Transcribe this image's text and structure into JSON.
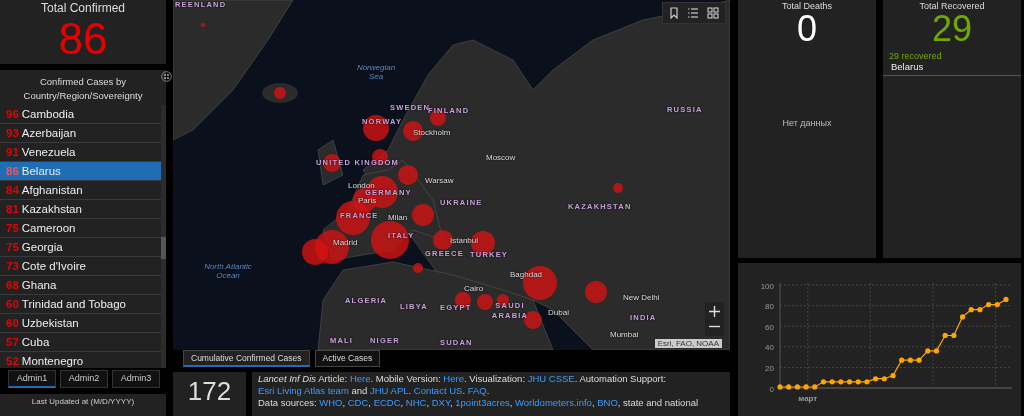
{
  "total_confirmed": {
    "title": "Total Confirmed",
    "value": "86"
  },
  "cases_list": {
    "title": "Confirmed Cases by Country/Region/Sovereignty",
    "rows": [
      {
        "count": "96",
        "name": "Cambodia",
        "selected": false
      },
      {
        "count": "93",
        "name": "Azerbaijan",
        "selected": false
      },
      {
        "count": "91",
        "name": "Venezuela",
        "selected": false
      },
      {
        "count": "86",
        "name": "Belarus",
        "selected": true
      },
      {
        "count": "84",
        "name": "Afghanistan",
        "selected": false
      },
      {
        "count": "81",
        "name": "Kazakhstan",
        "selected": false
      },
      {
        "count": "75",
        "name": "Cameroon",
        "selected": false
      },
      {
        "count": "75",
        "name": "Georgia",
        "selected": false
      },
      {
        "count": "73",
        "name": "Cote d'Ivoire",
        "selected": false
      },
      {
        "count": "68",
        "name": "Ghana",
        "selected": false
      },
      {
        "count": "60",
        "name": "Trinidad and Tobago",
        "selected": false
      },
      {
        "count": "60",
        "name": "Uzbekistan",
        "selected": false
      },
      {
        "count": "57",
        "name": "Cuba",
        "selected": false
      },
      {
        "count": "52",
        "name": "Montenegro",
        "selected": false
      }
    ]
  },
  "admin_tabs": [
    {
      "label": "Admin1",
      "selected": true
    },
    {
      "label": "Admin2",
      "selected": false
    },
    {
      "label": "Admin3",
      "selected": false
    }
  ],
  "last_updated": {
    "label": "Last Updated at (M/D/YYYY)"
  },
  "map": {
    "labels": [
      {
        "text": "REENLAND",
        "kind": "country"
      },
      {
        "text": "Norwegian Sea",
        "kind": "water"
      },
      {
        "text": "SWEDEN",
        "kind": "country"
      },
      {
        "text": "FINLAND",
        "kind": "country"
      },
      {
        "text": "NORWAY",
        "kind": "country"
      },
      {
        "text": "RUSSIA",
        "kind": "country"
      },
      {
        "text": "Stockholm",
        "kind": "city"
      },
      {
        "text": "Moscow",
        "kind": "city"
      },
      {
        "text": "UNITED KINGDOM",
        "kind": "country"
      },
      {
        "text": "London",
        "kind": "city"
      },
      {
        "text": "Warsaw",
        "kind": "city"
      },
      {
        "text": "GERMANY",
        "kind": "country"
      },
      {
        "text": "Paris",
        "kind": "city"
      },
      {
        "text": "UKRAINE",
        "kind": "country"
      },
      {
        "text": "KAZAKHSTAN",
        "kind": "country"
      },
      {
        "text": "FRANCE",
        "kind": "country"
      },
      {
        "text": "Milan",
        "kind": "city"
      },
      {
        "text": "ITALY",
        "kind": "country"
      },
      {
        "text": "Madrid",
        "kind": "city"
      },
      {
        "text": "Istanbul",
        "kind": "city"
      },
      {
        "text": "North Atlantic Ocean",
        "kind": "water"
      },
      {
        "text": "GREECE",
        "kind": "country"
      },
      {
        "text": "TURKEY",
        "kind": "country"
      },
      {
        "text": "Baghdad",
        "kind": "city"
      },
      {
        "text": "Cairo",
        "kind": "city"
      },
      {
        "text": "ALGERIA",
        "kind": "country"
      },
      {
        "text": "LIBYA",
        "kind": "country"
      },
      {
        "text": "EGYPT",
        "kind": "country"
      },
      {
        "text": "SAUDI ARABIA",
        "kind": "country"
      },
      {
        "text": "New Delhi",
        "kind": "city"
      },
      {
        "text": "Dubai",
        "kind": "city"
      },
      {
        "text": "INDIA",
        "kind": "country"
      },
      {
        "text": "Mumbai",
        "kind": "city"
      },
      {
        "text": "MALI",
        "kind": "country"
      },
      {
        "text": "NIGER",
        "kind": "country"
      },
      {
        "text": "SUDAN",
        "kind": "country"
      }
    ],
    "attribution": "Esri, FAO, NOAA"
  },
  "map_tabs": [
    {
      "label": "Cumulative Confirmed Cases",
      "selected": true
    },
    {
      "label": "Active Cases",
      "selected": false
    }
  ],
  "country_count": "172",
  "info": {
    "segments": [
      {
        "kind": "italic",
        "text": "Lancet Inf Dis"
      },
      {
        "kind": "text",
        "text": " Article: "
      },
      {
        "kind": "link",
        "text": "Here"
      },
      {
        "kind": "text",
        "text": ". Mobile Version: "
      },
      {
        "kind": "link",
        "text": "Here"
      },
      {
        "kind": "text",
        "text": ". Visualization: "
      },
      {
        "kind": "link",
        "text": "JHU CSSE"
      },
      {
        "kind": "text",
        "text": ". Automation Support: "
      },
      {
        "kind": "link",
        "text": "Esri Living Atlas team"
      },
      {
        "kind": "text",
        "text": " and "
      },
      {
        "kind": "link",
        "text": "JHU APL"
      },
      {
        "kind": "text",
        "text": ". "
      },
      {
        "kind": "link",
        "text": "Contact US"
      },
      {
        "kind": "text",
        "text": ". "
      },
      {
        "kind": "link",
        "text": "FAQ"
      },
      {
        "kind": "text",
        "text": "."
      },
      {
        "kind": "break"
      },
      {
        "kind": "text",
        "text": "Data sources: "
      },
      {
        "kind": "link",
        "text": "WHO"
      },
      {
        "kind": "text",
        "text": ", "
      },
      {
        "kind": "link",
        "text": "CDC"
      },
      {
        "kind": "text",
        "text": ", "
      },
      {
        "kind": "link",
        "text": "ECDC"
      },
      {
        "kind": "text",
        "text": ", "
      },
      {
        "kind": "link",
        "text": "NHC"
      },
      {
        "kind": "text",
        "text": ", "
      },
      {
        "kind": "link",
        "text": "DXY"
      },
      {
        "kind": "text",
        "text": ", "
      },
      {
        "kind": "link",
        "text": "1point3acres"
      },
      {
        "kind": "text",
        "text": ", "
      },
      {
        "kind": "link",
        "text": "Worldometers.info"
      },
      {
        "kind": "text",
        "text": ", "
      },
      {
        "kind": "link",
        "text": "BNO"
      },
      {
        "kind": "text",
        "text": ", state and national"
      }
    ]
  },
  "total_deaths": {
    "title": "Total Deaths",
    "value": "0",
    "empty_message": "Нет данных"
  },
  "total_recovered": {
    "title": "Total Recovered",
    "value": "29",
    "items": [
      {
        "count": "29",
        "label": "recovered",
        "place": "Belarus"
      }
    ]
  },
  "trend": {
    "chart_data": {
      "type": "line",
      "grid": true,
      "series": [
        {
          "color": "#ffa500",
          "values": [
            1,
            1,
            1,
            1,
            1,
            6,
            6,
            6,
            6,
            6,
            6,
            9,
            9,
            12,
            27,
            27,
            27,
            36,
            36,
            51,
            51,
            69,
            76,
            76,
            81,
            81,
            86
          ]
        }
      ],
      "ylim": [
        0,
        100
      ],
      "yticks": [
        0,
        20,
        40,
        60,
        80,
        100
      ]
    },
    "x_axis_label": "март"
  }
}
